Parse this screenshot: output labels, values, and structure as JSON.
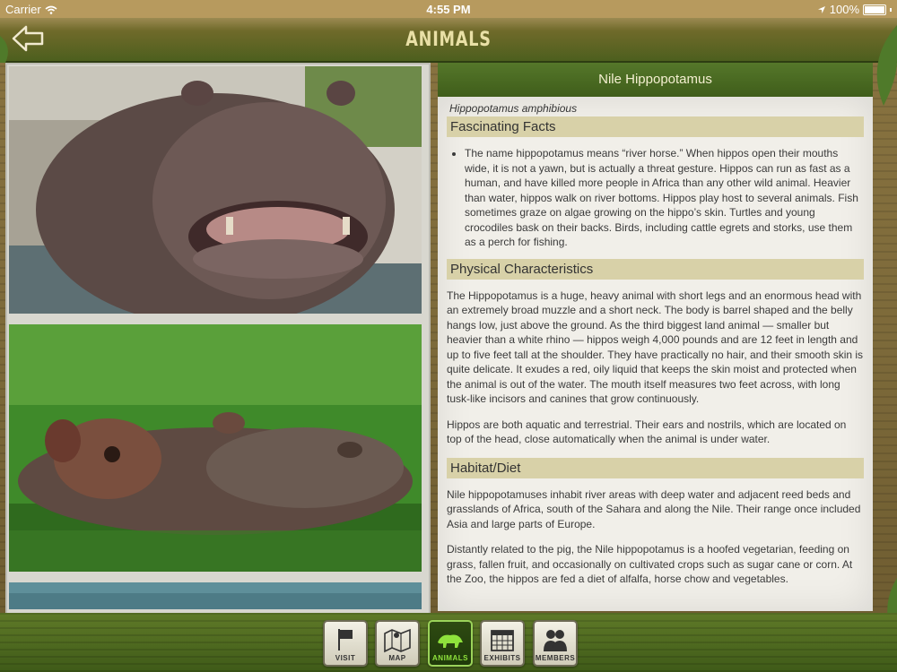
{
  "status": {
    "carrier": "Carrier",
    "time": "4:55 PM",
    "battery": "100%"
  },
  "header": {
    "title": "ANIMALS"
  },
  "article": {
    "heading": "Nile Hippopotamus",
    "scientific_name": "Hippopotamus amphibious",
    "sections": {
      "facts_title": "Fascinating Facts",
      "facts_item": "The name hippopotamus means “river horse.” When hippos open their mouths wide, it is not a yawn, but is actually a threat gesture. Hippos can run as fast as a human, and have killed more people in Africa than any other wild animal. Heavier than water, hippos walk on river bottoms. Hippos play host to several animals. Fish sometimes graze on algae growing on the hippo’s skin. Turtles and young crocodiles bask on their backs. Birds, including cattle egrets and storks, use them as a perch for fishing.",
      "physical_title": "Physical Characteristics",
      "physical_p1": "The Hippopotamus is a huge, heavy animal with short legs and an enormous head with an extremely broad muzzle and a short neck. The body is barrel shaped and the belly hangs low, just above the ground. As the third biggest land animal — smaller but heavier than a white rhino — hippos weigh 4,000 pounds and are 12 feet in length and up to five feet tall at the shoulder. They have practically no hair, and their smooth skin is quite delicate. It exudes a red, oily liquid that keeps the skin moist and protected when the animal is out of the water. The mouth itself measures two feet across, with long tusk-like incisors and canines that grow continuously.",
      "physical_p2": "Hippos are both aquatic and terrestrial. Their ears and nostrils, which are located on top of the head, close automatically when the animal is under water.",
      "habitat_title": "Habitat/Diet",
      "habitat_p1": "Nile hippopotamuses inhabit river areas with deep water and adjacent reed beds and grasslands of Africa, south of the Sahara and along the Nile. Their range once included Asia and large parts of Europe.",
      "habitat_p2": "Distantly related to the pig, the Nile hippopotamus is a hoofed vegetarian, feeding on grass, fallen fruit, and occasionally on cultivated crops such as sugar cane or corn. At the Zoo, the hippos are fed a diet of alfalfa, horse chow and vegetables."
    }
  },
  "toolbar": {
    "tabs": [
      {
        "label": "VISIT",
        "icon": "flag-icon"
      },
      {
        "label": "MAP",
        "icon": "map-icon"
      },
      {
        "label": "ANIMALS",
        "icon": "animal-icon"
      },
      {
        "label": "EXHIBITS",
        "icon": "calendar-icon"
      },
      {
        "label": "MEMBERS",
        "icon": "members-icon"
      }
    ]
  },
  "colors": {
    "header_green": "#4d5f1e",
    "title_text": "#e9e0a6",
    "section_band": "#d8d1a8",
    "active_tab_label": "#8fe23c"
  }
}
